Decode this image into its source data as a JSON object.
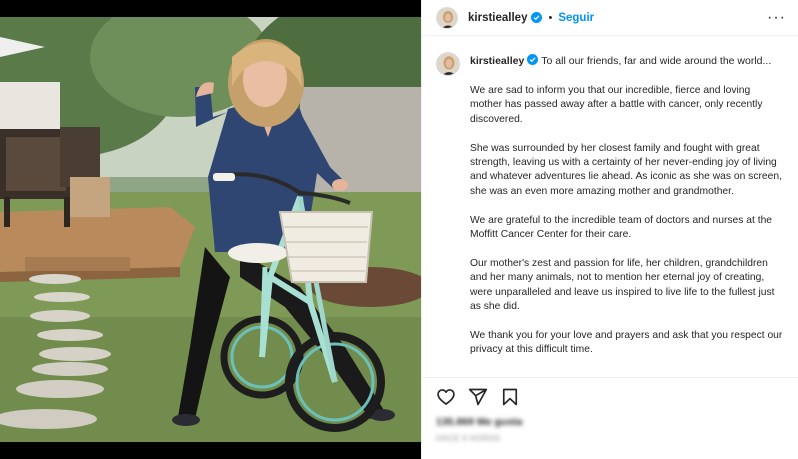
{
  "post": {
    "username": "kirstiealley",
    "follow_label": "Seguir",
    "separator": "•",
    "more_label": "···",
    "caption_lead": "To all our friends, far and wide around the world...",
    "caption_paragraphs": [
      "We are sad to inform you that our incredible, fierce and loving mother has passed away after a battle with cancer, only recently discovered.",
      "She was surrounded by her closest family and fought with great strength, leaving us with a certainty of her never-ending joy of living and whatever adventures lie ahead. As iconic as she was on screen, she was an even more amazing mother and grandmother.",
      "We are grateful to the incredible team of doctors and nurses at the Moffitt Cancer Center for their care.",
      "Our mother's zest and passion for life, her children, grandchildren and her many animals, not to mention her eternal joy of creating, were unparalleled and leave us inspired to live life to the fullest just as she did.",
      "We thank you for your love and prayers and ask that you respect our privacy at this difficult time."
    ],
    "likes_text": "135.869 Me gusta",
    "date_text": "HACE 6 HORAS"
  },
  "icons": {
    "verified": "verified-badge-icon",
    "like": "heart-icon",
    "share": "paper-plane-icon",
    "save": "bookmark-icon"
  },
  "colors": {
    "accent": "#0095f6",
    "text": "#262626",
    "muted": "#8e8e8e",
    "border": "#efefef"
  }
}
